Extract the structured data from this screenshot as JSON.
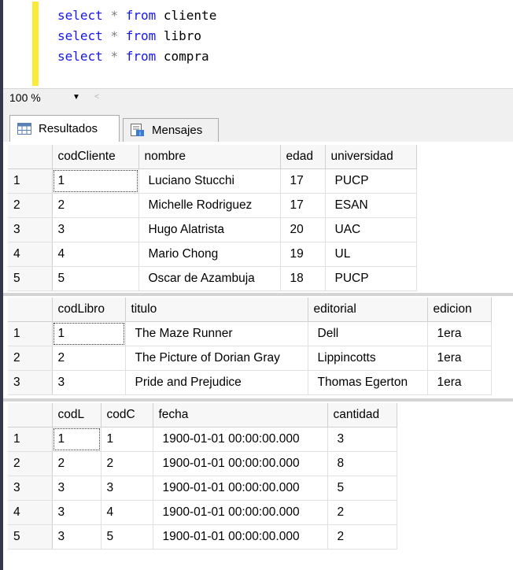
{
  "editor": {
    "lines": [
      {
        "kw1": "select",
        "op": "*",
        "kw2": "from",
        "table": "cliente"
      },
      {
        "kw1": "select",
        "op": "*",
        "kw2": "from",
        "table": "libro"
      },
      {
        "kw1": "select",
        "op": "*",
        "kw2": "from",
        "table": "compra"
      }
    ]
  },
  "zoom": {
    "value": "100 %"
  },
  "tabs": {
    "results": "Resultados",
    "messages": "Mensajes"
  },
  "grids": [
    {
      "columns": [
        "codCliente",
        "nombre",
        "edad",
        "universidad"
      ],
      "rows": [
        [
          "1",
          "1",
          "Luciano Stucchi",
          "17",
          "PUCP"
        ],
        [
          "2",
          "2",
          "Michelle Rodriguez",
          "17",
          "ESAN"
        ],
        [
          "3",
          "3",
          "Hugo Alatrista",
          "20",
          "UAC"
        ],
        [
          "4",
          "4",
          "Mario Chong",
          "19",
          "UL"
        ],
        [
          "5",
          "5",
          "Oscar de Azambuja",
          "18",
          "PUCP"
        ]
      ]
    },
    {
      "columns": [
        "codLibro",
        "titulo",
        "editorial",
        "edicion"
      ],
      "rows": [
        [
          "1",
          "1",
          "The Maze Runner",
          "Dell",
          "1era"
        ],
        [
          "2",
          "2",
          "The Picture of Dorian Gray",
          "Lippincotts",
          "1era"
        ],
        [
          "3",
          "3",
          "Pride and Prejudice",
          "Thomas Egerton",
          "1era"
        ]
      ]
    },
    {
      "columns": [
        "codL",
        "codC",
        "fecha",
        "cantidad"
      ],
      "rows": [
        [
          "1",
          "1",
          "1",
          "1900-01-01 00:00:00.000",
          "3"
        ],
        [
          "2",
          "2",
          "2",
          "1900-01-01 00:00:00.000",
          "8"
        ],
        [
          "3",
          "3",
          "3",
          "1900-01-01 00:00:00.000",
          "5"
        ],
        [
          "4",
          "3",
          "4",
          "1900-01-01 00:00:00.000",
          "2"
        ],
        [
          "5",
          "3",
          "5",
          "1900-01-01 00:00:00.000",
          "2"
        ]
      ]
    }
  ]
}
